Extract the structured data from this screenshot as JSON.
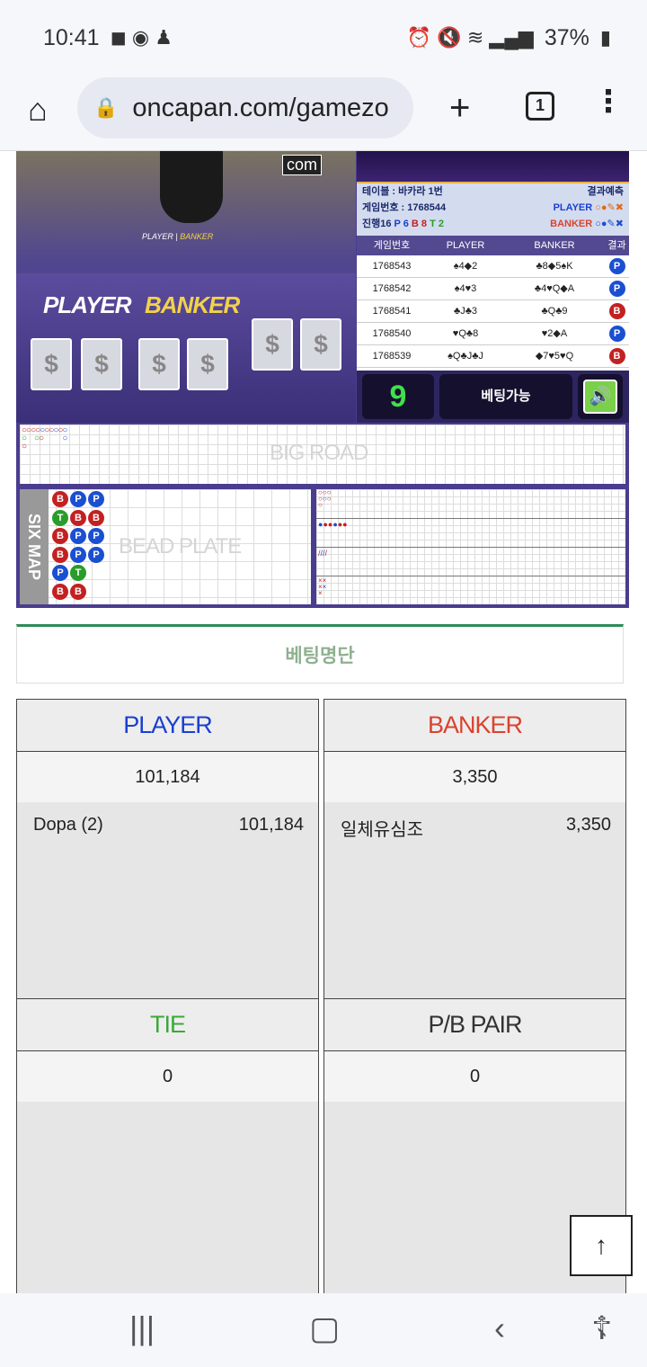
{
  "status_bar": {
    "time": "10:41",
    "battery": "37%"
  },
  "browser": {
    "url": "oncapan.com/gamezo",
    "tab_count": "1"
  },
  "game": {
    "com_logo": "com",
    "video_small_player": "PLAYER",
    "video_small_banker": "BANKER",
    "video_player_label": "PLAYER",
    "video_banker_label": "BANKER",
    "card_back_symbol": "$",
    "info": {
      "table": "테이블 : 바카라 1번",
      "prediction_label": "결과예측",
      "game_number": "게임번호 : 1768544",
      "progress": "진행16",
      "p_count": "P 6",
      "b_count": "B 8",
      "t_count": "T 2",
      "pred_player": "PLAYER",
      "pred_banker": "BANKER"
    },
    "history_headers": [
      "게임번호",
      "PLAYER",
      "BANKER",
      "결과"
    ],
    "history": [
      {
        "no": "1768543",
        "player": "♠4◆2",
        "banker": "♣8◆5♠K",
        "result": "P"
      },
      {
        "no": "1768542",
        "player": "♠4♥3",
        "banker": "♣4♥Q◆A",
        "result": "P"
      },
      {
        "no": "1768541",
        "player": "♣J♣3",
        "banker": "♣Q♣9",
        "result": "B"
      },
      {
        "no": "1768540",
        "player": "♥Q♣8",
        "banker": "♥2◆A",
        "result": "P"
      },
      {
        "no": "1768539",
        "player": "♠Q♣J♣J",
        "banker": "◆7♥5♥Q",
        "result": "B"
      }
    ],
    "countdown": "9",
    "betting_status": "베팅가능",
    "big_road_label": "BIG ROAD",
    "six_map_label": "SIX MAP",
    "bead_plate_label": "BEAD PLATE",
    "bead_columns": [
      [
        "B",
        "T",
        "B",
        "B",
        "P",
        "B"
      ],
      [
        "P",
        "B",
        "P",
        "P",
        "T",
        "B"
      ],
      [
        "P",
        "B",
        "P",
        "P"
      ]
    ]
  },
  "betting_list_title": "베팅명단",
  "panels": [
    {
      "title": "PLAYER",
      "total": "101,184",
      "entries": [
        {
          "name": "Dopa (2)",
          "amount": "101,184"
        }
      ]
    },
    {
      "title": "BANKER",
      "total": "3,350",
      "entries": [
        {
          "name": "일체유심조",
          "amount": "3,350"
        }
      ]
    },
    {
      "title": "TIE",
      "total": "0",
      "entries": []
    },
    {
      "title": "P/B PAIR",
      "total": "0",
      "entries": []
    }
  ],
  "colors": {
    "player": "#1b3fd1",
    "banker": "#d9432f",
    "tie": "#3aa83a",
    "pair": "#333333"
  }
}
